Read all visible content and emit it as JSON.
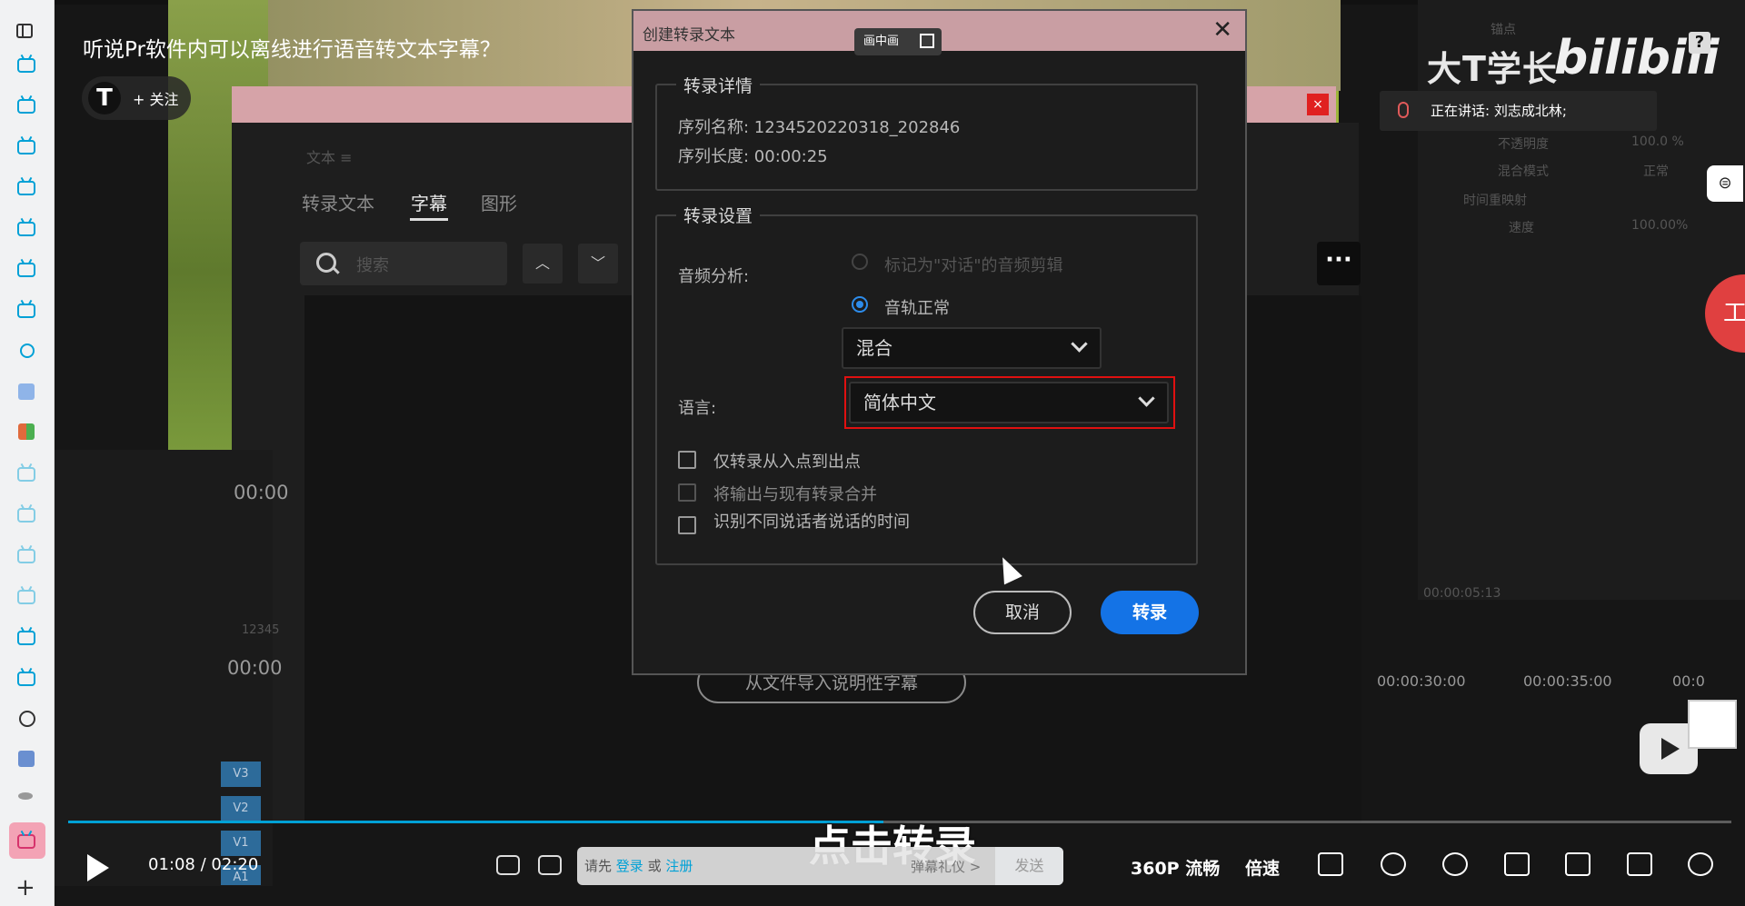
{
  "video": {
    "title": "听说Pr软件内可以离线进行语音转文本字幕？",
    "uploader_initial": "T",
    "follow_label": "+ 关注",
    "watermark_text": "大T学长",
    "watermark_logo": "bilibili",
    "speaking_text": "正在讲话: 刘志成北林;",
    "help_label": "?",
    "side_label": "工",
    "subtitle": "点击转录",
    "current_time": "01:08",
    "time_sep": "/",
    "duration": "02:20",
    "progress_fraction": 0.49
  },
  "premiere_bg": {
    "tabs": [
      "转录文本",
      "字幕",
      "图形"
    ],
    "active_tab": "字幕",
    "search_placeholder": "搜索",
    "timecode_1": "00:00",
    "timecode_2": "00:00",
    "import_button": "从文件导入说明性字幕",
    "ruler_1": "00:00:30:00",
    "ruler_2": "00:00:35:00",
    "ruler_3": "00:0",
    "right_time": "00:00:05:13",
    "track_labels": [
      "V3",
      "V2",
      "V1",
      "A1"
    ],
    "faint_top": "文本 ≡",
    "seq_label": "12345",
    "right_panel_items": [
      "锚点",
      "不透明度",
      "100.0 %",
      "混合模式",
      "正常",
      "时间重映射",
      "速度",
      "100.00%"
    ]
  },
  "dialog": {
    "title": "创建转录文本",
    "pip_label": "画中画",
    "section_details": "转录详情",
    "sequence_name": "序列名称: 1234520220318_202846",
    "sequence_length": "序列长度: 00:00:25",
    "section_settings": "转录设置",
    "audio_label": "音频分析:",
    "radio_dialogue": "标记为\"对话\"的音频剪辑",
    "radio_track": "音轨正常",
    "mix_value": "混合",
    "language_label": "语言:",
    "language_value": "简体中文",
    "checkbox_inout": "仅转录从入点到出点",
    "checkbox_merge": "将输出与现有转录合并",
    "checkbox_speakers": "识别不同说话者说话的时间",
    "cancel_label": "取消",
    "transcribe_label": "转录"
  },
  "controls": {
    "danmu_prefix": "请先 ",
    "danmu_login": "登录",
    "danmu_or": " 或 ",
    "danmu_register": "注册",
    "danmu_etiquette": "弹幕礼仪 >",
    "send_label": "发送",
    "quality": "360P 流畅",
    "speed": "倍速",
    "icons": [
      "danmu-toggle-icon",
      "danmu-settings-icon",
      "subtitle-icon",
      "mute-icon",
      "settings-icon",
      "pip-icon",
      "widescreen-icon",
      "webfullscreen-icon",
      "fullscreen-icon"
    ]
  },
  "colors": {
    "accent": "#00a1d6",
    "dialog_primary": "#1473e6",
    "highlight": "#e01010",
    "dialog_title_bg": "#c99ea3"
  }
}
